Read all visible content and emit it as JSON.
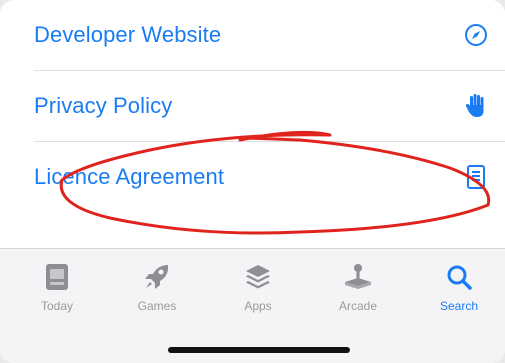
{
  "links": [
    {
      "label": "Developer Website",
      "icon": "compass-icon"
    },
    {
      "label": "Privacy Policy",
      "icon": "hand-icon"
    },
    {
      "label": "Licence Agreement",
      "icon": "document-icon"
    }
  ],
  "tabbar": {
    "tabs": [
      {
        "label": "Today",
        "icon": "today-icon",
        "active": false
      },
      {
        "label": "Games",
        "icon": "rocket-icon",
        "active": false
      },
      {
        "label": "Apps",
        "icon": "stack-icon",
        "active": false
      },
      {
        "label": "Arcade",
        "icon": "joystick-icon",
        "active": false
      },
      {
        "label": "Search",
        "icon": "search-icon",
        "active": true
      }
    ]
  },
  "colors": {
    "accent": "#1a7cf2",
    "inactive": "#9a9a9c",
    "annotation": "#e0231c"
  }
}
